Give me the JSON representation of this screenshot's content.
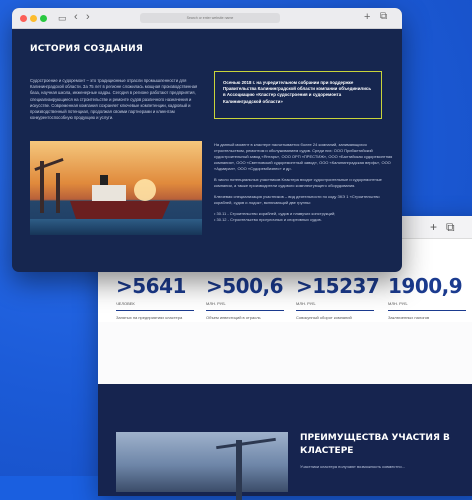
{
  "back_window": {
    "stats": [
      {
        "value": ">5641",
        "unit": "ЧЕЛОВЕК",
        "desc": "Занятых на предприятиях кластера"
      },
      {
        "value": ">500,6",
        "unit": "МЛН. РУБ.",
        "desc": "Объем инвестиций в отрасль"
      },
      {
        "value": ">15237",
        "unit": "МЛН. РУБ.",
        "desc": "Совокупный оборот компаний кластера"
      },
      {
        "value": "1900,9",
        "unit": "МЛН. РУБ.",
        "desc": "Заключенных налогов"
      }
    ],
    "advantages_title": "ПРЕИМУЩЕСТВА УЧАСТИЯ В КЛАСТЕРЕ",
    "advantages_text": "Участники кластера получают возможность совместно..."
  },
  "front_window": {
    "url": "Search or enter website name",
    "title": "ИСТОРИЯ СОЗДАНИЯ",
    "intro": "Судостроение и судоремонт – это традиционные отрасли промышленности для Калининградской области. За 75 лет в регионе сложилась мощная производственная база, научная школа, инженерные кадры. Сегодня в регионе работают предприятия, специализирующиеся на строительстве и ремонте судов различного назначения и искусстве. Современная компания сохраняет ключевые компетенции, кадровый и производственный потенциал, продолжая своими партнерами и клиентам конкурентоспособную продукцию и услуги.",
    "quote": "Осенью 2018 г. на учредительном собрании при поддержке Правительства Калининградской области компании объединились в Ассоциацию «Кластер судостроения и судоремонта Калининградской области»",
    "right_paragraphs": [
      "На данный момент в кластере насчитывается более 24 компаний, занимающихся строительством, ремонтом и обслуживанием судов. Среди них: ООО Прибалтийский судостроительный завод «Янтарь», ООО ОРП «ПРЕСТИЖ», ООО «Балтийская судоремонтная компания», ООО «Светловский судоремонтный завод», ООО «Калининградская верфь», ООО «Адмирал», ООО «Судорембизнес» и др.",
      "В число потенциальных участников Кластера входят судостроительные и судоремонтные компании, а также производители судового комплектующего оборудования.",
      "Ключевая специализация участников – вид деятельности по коду ЗКЭ 1 «Строительство кораблей, судов и лодок», включающий две группы:",
      "• 30.11 - Строительство кораблей, судов и плавучих конструкций;",
      "• 30.12 - Строительство прогулочных и спортивных судов."
    ]
  }
}
